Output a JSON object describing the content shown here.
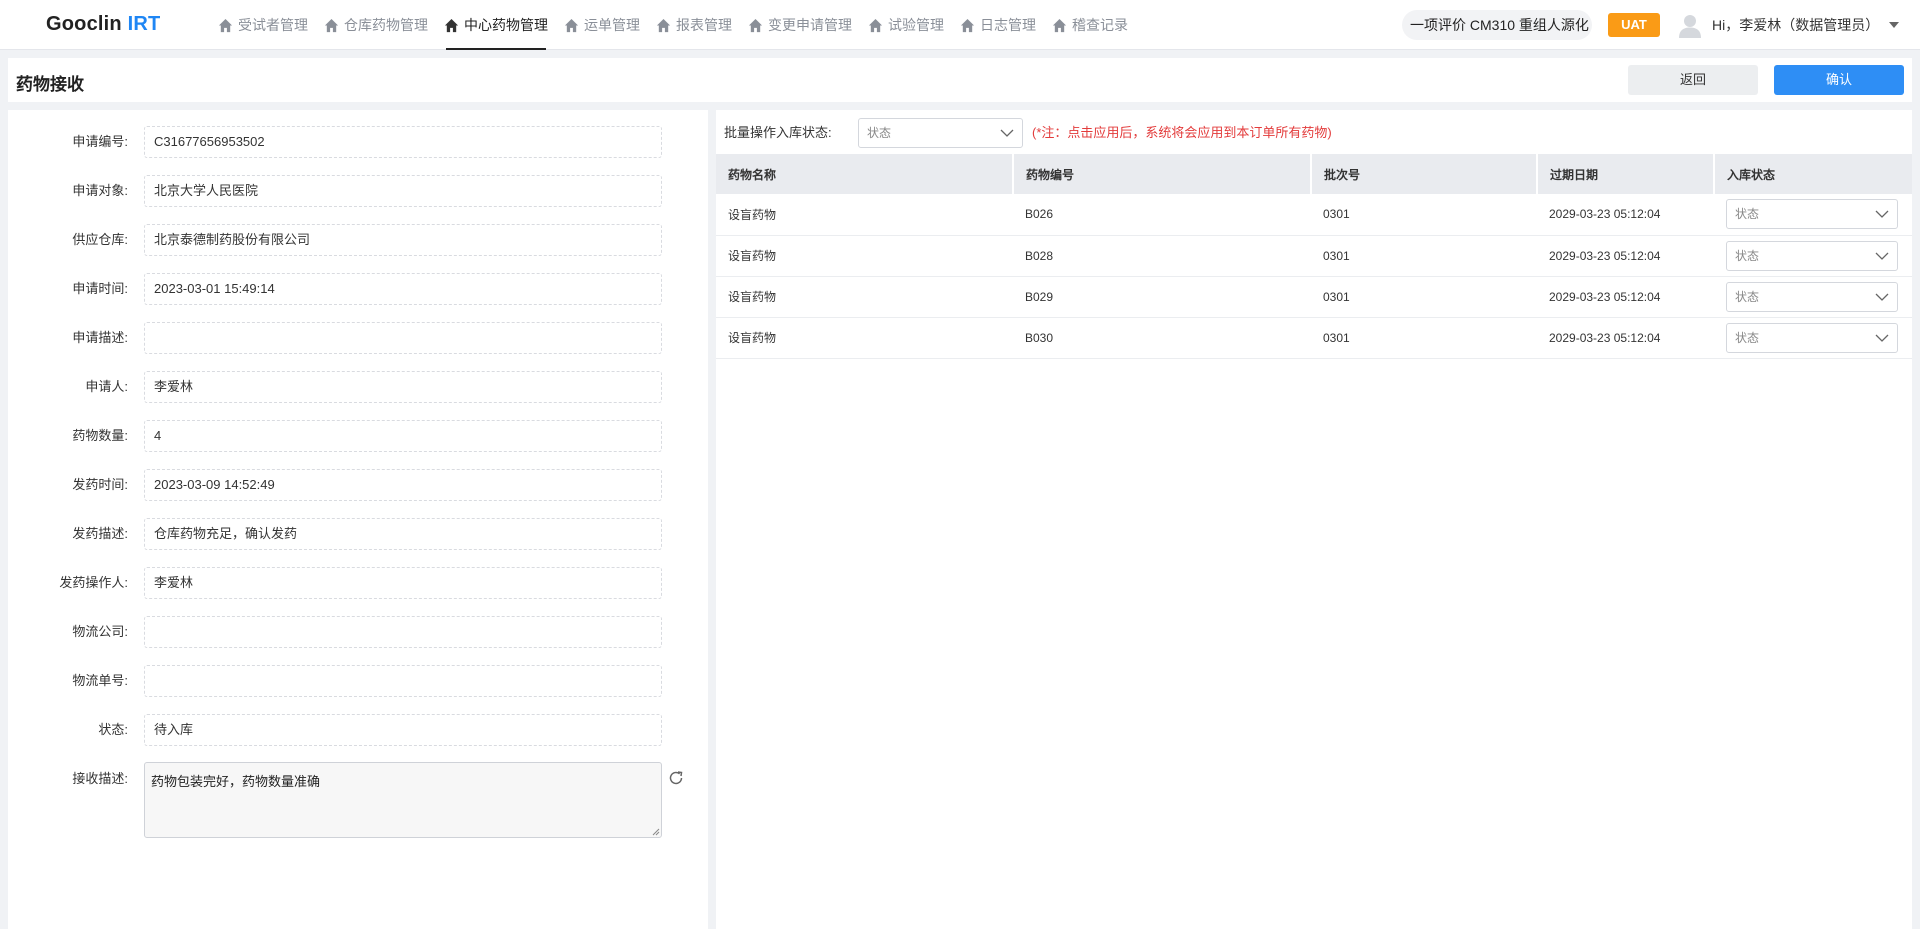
{
  "brand": {
    "name": "Gooclin",
    "suffix": "IRT"
  },
  "nav": [
    {
      "label": "受试者管理",
      "active": false
    },
    {
      "label": "仓库药物管理",
      "active": false
    },
    {
      "label": "中心药物管理",
      "active": true
    },
    {
      "label": "运单管理",
      "active": false
    },
    {
      "label": "报表管理",
      "active": false
    },
    {
      "label": "变更申请管理",
      "active": false
    },
    {
      "label": "试验管理",
      "active": false
    },
    {
      "label": "日志管理",
      "active": false
    },
    {
      "label": "稽查记录",
      "active": false
    }
  ],
  "project": "一项评价 CM310 重组人源化",
  "env_badge": "UAT",
  "user": "Hi，李爱林（数据管理员）",
  "page": {
    "title": "药物接收",
    "back_label": "返回",
    "confirm_label": "确认"
  },
  "form": [
    {
      "label": "申请编号:",
      "value": "C31677656953502"
    },
    {
      "label": "申请对象:",
      "value": "北京大学人民医院"
    },
    {
      "label": "供应仓库:",
      "value": "北京泰德制药股份有限公司"
    },
    {
      "label": "申请时间:",
      "value": "2023-03-01 15:49:14"
    },
    {
      "label": "申请描述:",
      "value": ""
    },
    {
      "label": "申请人:",
      "value": "李爱林"
    },
    {
      "label": "药物数量:",
      "value": "4"
    },
    {
      "label": "发药时间:",
      "value": "2023-03-09 14:52:49"
    },
    {
      "label": "发药描述:",
      "value": "仓库药物充足，确认发药"
    },
    {
      "label": "发药操作人:",
      "value": "李爱林"
    },
    {
      "label": "物流公司:",
      "value": ""
    },
    {
      "label": "物流单号:",
      "value": ""
    },
    {
      "label": "状态:",
      "value": "待入库"
    }
  ],
  "receive": {
    "label": "接收描述:",
    "value": "药物包装完好，药物数量准确"
  },
  "batch": {
    "label": "批量操作入库状态:",
    "placeholder": "状态",
    "note": "(*注：点击应用后，系统将会应用到本订单所有药物)"
  },
  "table": {
    "columns": [
      "药物名称",
      "药物编号",
      "批次号",
      "过期日期",
      "入库状态"
    ],
    "rows": [
      {
        "name": "设盲药物",
        "code": "B026",
        "batch": "0301",
        "expiry": "2029-03-23 05:12:04",
        "status": "状态"
      },
      {
        "name": "设盲药物",
        "code": "B028",
        "batch": "0301",
        "expiry": "2029-03-23 05:12:04",
        "status": "状态"
      },
      {
        "name": "设盲药物",
        "code": "B029",
        "batch": "0301",
        "expiry": "2029-03-23 05:12:04",
        "status": "状态"
      },
      {
        "name": "设盲药物",
        "code": "B030",
        "batch": "0301",
        "expiry": "2029-03-23 05:12:04",
        "status": "状态"
      }
    ]
  }
}
